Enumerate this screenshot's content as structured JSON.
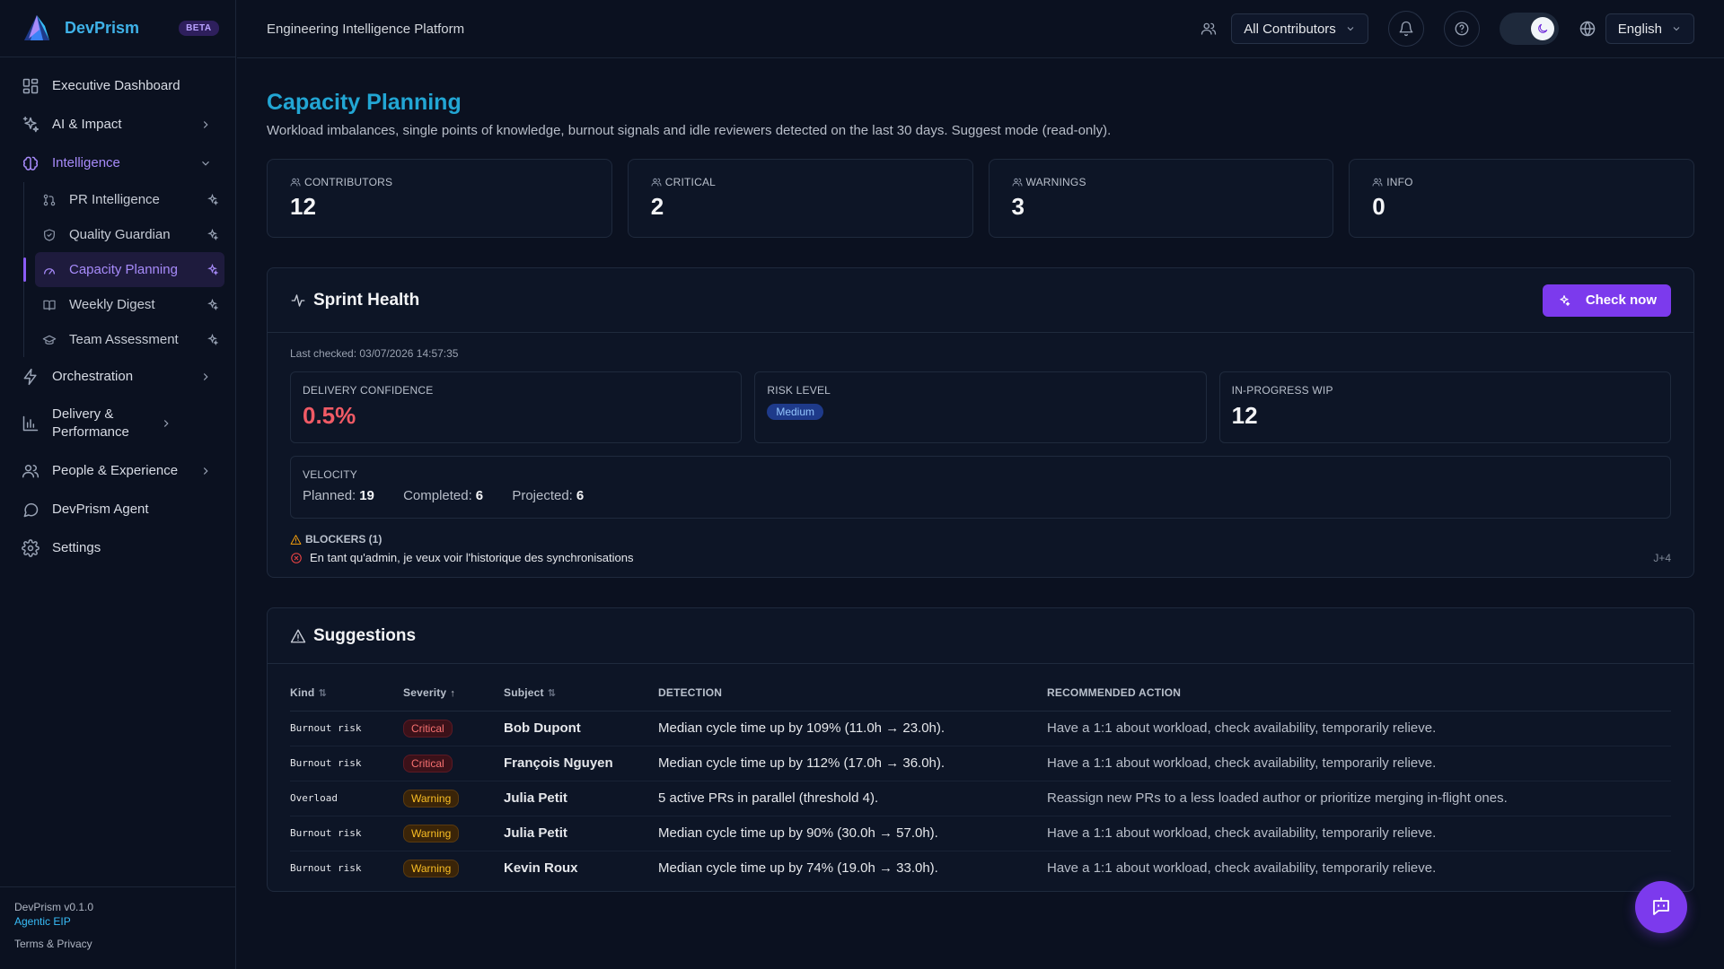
{
  "brand": {
    "name": "DevPrism",
    "badge": "BETA"
  },
  "sidebar": {
    "items": [
      {
        "label": "Executive Dashboard",
        "icon": "dashboard-icon"
      },
      {
        "label": "AI & Impact",
        "icon": "sparkles-icon"
      },
      {
        "label": "Intelligence",
        "icon": "brain-icon"
      },
      {
        "label": "Orchestration",
        "icon": "bolt-icon"
      },
      {
        "label": "Delivery & Performance",
        "icon": "bar-chart-icon"
      },
      {
        "label": "People & Experience",
        "icon": "users-icon"
      },
      {
        "label": "DevPrism Agent",
        "icon": "chat-icon"
      },
      {
        "label": "Settings",
        "icon": "gear-icon"
      }
    ],
    "intelligence_sub": [
      {
        "label": "PR Intelligence",
        "icon": "git-pull-request-icon"
      },
      {
        "label": "Quality Guardian",
        "icon": "shield-icon"
      },
      {
        "label": "Capacity Planning",
        "icon": "gauge-icon"
      },
      {
        "label": "Weekly Digest",
        "icon": "book-icon"
      },
      {
        "label": "Team Assessment",
        "icon": "graduation-cap-icon"
      }
    ],
    "footer": {
      "version": "DevPrism v0.1.0",
      "subtitle": "Agentic EIP",
      "terms": "Terms & Privacy"
    }
  },
  "topbar": {
    "title": "Engineering Intelligence Platform",
    "contributors_select": "All Contributors",
    "language_select": "English"
  },
  "page": {
    "title": "Capacity Planning",
    "subtitle": "Workload imbalances, single points of knowledge, burnout signals and idle reviewers detected on the last 30 days. Suggest mode (read-only)."
  },
  "kpis": [
    {
      "label": "CONTRIBUTORS",
      "value": "12"
    },
    {
      "label": "CRITICAL",
      "value": "2"
    },
    {
      "label": "WARNINGS",
      "value": "3"
    },
    {
      "label": "INFO",
      "value": "0"
    }
  ],
  "sprint_health": {
    "title": "Sprint Health",
    "check_button": "Check now",
    "last_checked": "Last checked: 03/07/2026 14:57:35",
    "delivery_confidence_label": "DELIVERY CONFIDENCE",
    "delivery_confidence_value": "0.5%",
    "risk_level_label": "RISK LEVEL",
    "risk_level_value": "Medium",
    "wip_label": "IN-PROGRESS WIP",
    "wip_value": "12",
    "velocity_label": "VELOCITY",
    "planned_label": "Planned:",
    "planned_value": "19",
    "completed_label": "Completed:",
    "completed_value": "6",
    "projected_label": "Projected:",
    "projected_value": "6",
    "blockers_label": "BLOCKERS (1)",
    "blocker_text": "En tant qu'admin, je veux voir l'historique des synchronisations",
    "blocker_due": "J+4"
  },
  "suggestions": {
    "title": "Suggestions",
    "columns": {
      "kind": "Kind",
      "severity": "Severity",
      "subject": "Subject",
      "detection": "DETECTION",
      "action": "RECOMMENDED ACTION"
    },
    "rows": [
      {
        "kind": "Burnout risk",
        "severity": "Critical",
        "subject": "Bob Dupont",
        "detection": "Median cycle time up by 109% (11.0h → 23.0h).",
        "action": "Have a 1:1 about workload, check availability, temporarily relieve."
      },
      {
        "kind": "Burnout risk",
        "severity": "Critical",
        "subject": "François Nguyen",
        "detection": "Median cycle time up by 112% (17.0h → 36.0h).",
        "action": "Have a 1:1 about workload, check availability, temporarily relieve."
      },
      {
        "kind": "Overload",
        "severity": "Warning",
        "subject": "Julia Petit",
        "detection": "5 active PRs in parallel (threshold 4).",
        "action": "Reassign new PRs to a less loaded author or prioritize merging in-flight ones."
      },
      {
        "kind": "Burnout risk",
        "severity": "Warning",
        "subject": "Julia Petit",
        "detection": "Median cycle time up by 90% (30.0h → 57.0h).",
        "action": "Have a 1:1 about workload, check availability, temporarily relieve."
      },
      {
        "kind": "Burnout risk",
        "severity": "Warning",
        "subject": "Kevin Roux",
        "detection": "Median cycle time up by 74% (19.0h → 33.0h).",
        "action": "Have a 1:1 about workload, check availability, temporarily relieve."
      }
    ]
  },
  "colors": {
    "accent": "#7c3aed",
    "title": "#22a6d4",
    "critical": "#f87171",
    "warning": "#fbbf24"
  }
}
